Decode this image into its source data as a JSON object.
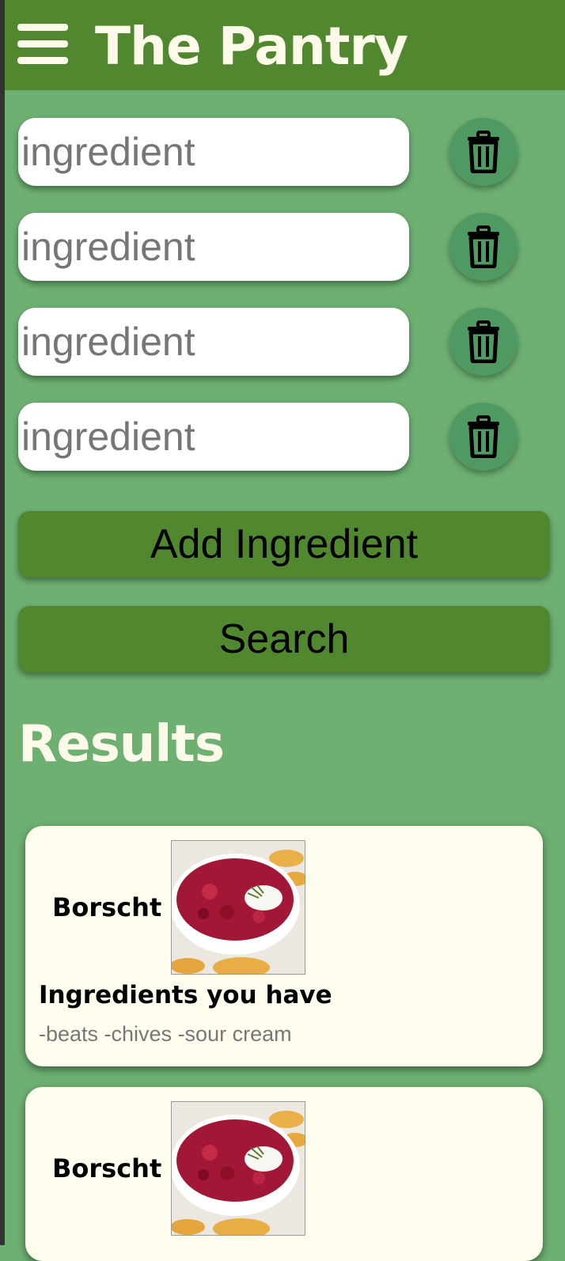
{
  "header": {
    "title": "The Pantry",
    "menu_icon": "hamburger-menu-icon"
  },
  "ingredients": [
    {
      "placeholder": "ingredient",
      "delete_icon": "trash-icon"
    },
    {
      "placeholder": "ingredient",
      "delete_icon": "trash-icon"
    },
    {
      "placeholder": "ingredient",
      "delete_icon": "trash-icon"
    },
    {
      "placeholder": "ingredient",
      "delete_icon": "trash-icon"
    }
  ],
  "buttons": {
    "add_label": "Add Ingredient",
    "search_label": "Search"
  },
  "results": {
    "heading": "Results",
    "items": [
      {
        "name": "Borscht",
        "have_heading": "Ingredients you have",
        "have_list": "-beats -chives -sour cream"
      },
      {
        "name": "Borscht"
      }
    ]
  },
  "colors": {
    "header": "#51882f",
    "background": "#6db072",
    "header_text": "#fefaea",
    "card": "#fefdee",
    "trash_button": "#4f9a63"
  }
}
